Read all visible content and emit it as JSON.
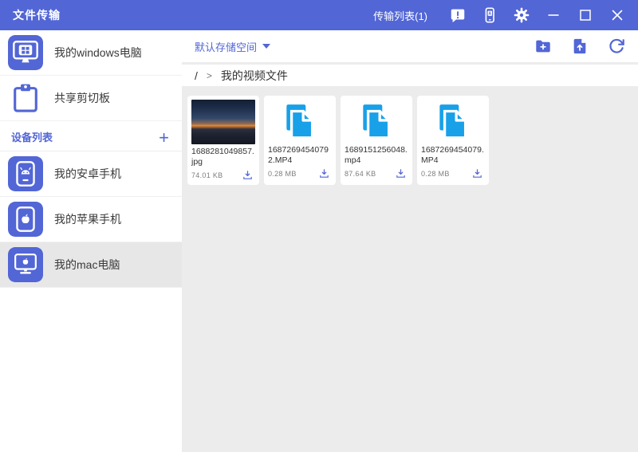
{
  "colors": {
    "primary": "#5266D6",
    "file_icon_blue": "#18A0E8",
    "main_background": "#ECECEC",
    "selected_row": "#E7E7E7"
  },
  "titlebar": {
    "title": "文件传输",
    "transfer_list_label": "传输列表(1)",
    "icons": [
      "feedback-bubble-icon",
      "phone-screen-icon",
      "settings-gear-icon"
    ],
    "window_controls": [
      "minimize",
      "maximize",
      "close"
    ]
  },
  "sidebar": {
    "computer": {
      "label": "我的windows电脑",
      "icon": "windows-computer-icon"
    },
    "clipboard": {
      "label": "共享剪切板",
      "icon": "clipboard-icon"
    },
    "device_section": {
      "title": "设备列表",
      "add_label": "+"
    },
    "devices": [
      {
        "label": "我的安卓手机",
        "type": "android-phone",
        "selected": false
      },
      {
        "label": "我的苹果手机",
        "type": "apple-phone",
        "selected": false
      },
      {
        "label": "我的mac电脑",
        "type": "mac-computer",
        "selected": true
      }
    ]
  },
  "toolbar": {
    "storage_selector": "默认存储空间",
    "icons": [
      "new-folder-icon",
      "upload-file-icon",
      "refresh-icon"
    ]
  },
  "breadcrumb": {
    "root": "/",
    "separator": ">",
    "current": "我的视频文件"
  },
  "files": [
    {
      "name": "1688281049857.jpg",
      "size": "74.01  KB",
      "kind": "image"
    },
    {
      "name": "1687269454079 2.MP4",
      "size": "0.28  MB",
      "kind": "video"
    },
    {
      "name": "1689151256048.mp4",
      "size": "87.64  KB",
      "kind": "video"
    },
    {
      "name": "1687269454079.MP4",
      "size": "0.28  MB",
      "kind": "video"
    }
  ]
}
